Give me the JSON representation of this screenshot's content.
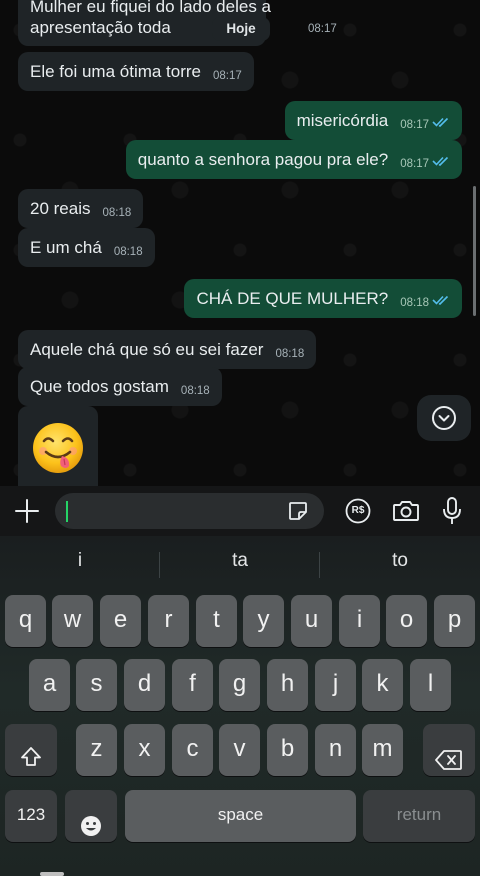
{
  "chat": {
    "date_chip": "Hoje",
    "messages": [
      {
        "dir": "in",
        "lines": [
          "Mulher eu fiquei do lado deles a",
          "apresentação toda"
        ],
        "time": "08:17"
      },
      {
        "dir": "in",
        "text": "Ele foi uma ótima torre",
        "time": "08:17"
      },
      {
        "dir": "out",
        "text": "misericórdia",
        "time": "08:17",
        "status": "read"
      },
      {
        "dir": "out",
        "text": "quanto a senhora pagou pra ele?",
        "time": "08:17",
        "status": "read"
      },
      {
        "dir": "in",
        "text": "20 reais",
        "time": "08:18"
      },
      {
        "dir": "in",
        "text": "E um chá",
        "time": "08:18"
      },
      {
        "dir": "out",
        "text": "CHÁ DE QUE MULHER?",
        "time": "08:18",
        "status": "read"
      },
      {
        "dir": "in",
        "text": "Aquele chá que só eu sei fazer",
        "time": "08:18"
      },
      {
        "dir": "in",
        "text": "Que todos gostam",
        "time": "08:18"
      },
      {
        "dir": "in",
        "emoji": "face-savoring-food",
        "time": ""
      }
    ],
    "scroll_down_icon": "chevron-down-circle-icon"
  },
  "input_bar": {
    "attach_icon": "plus-icon",
    "text_value": "",
    "sticker_icon": "sticker-icon",
    "currency_label": "R$",
    "camera_icon": "camera-icon",
    "mic_icon": "microphone-icon"
  },
  "keyboard": {
    "suggestions": [
      "i",
      "ta",
      "to"
    ],
    "row1": [
      "q",
      "w",
      "e",
      "r",
      "t",
      "y",
      "u",
      "i",
      "o",
      "p"
    ],
    "row2": [
      "a",
      "s",
      "d",
      "f",
      "g",
      "h",
      "j",
      "k",
      "l"
    ],
    "row3": [
      "z",
      "x",
      "c",
      "v",
      "b",
      "n",
      "m"
    ],
    "numbers_key": "123",
    "space_key": "space",
    "return_key": "return",
    "emoji_key_icon": "emoji-icon",
    "shift_icon": "shift-icon",
    "delete_icon": "delete-icon"
  },
  "colors": {
    "incoming_bubble": "#1f2427",
    "outgoing_bubble": "#134d37",
    "read_ticks": "#53bdeb",
    "caret": "#25d366"
  }
}
